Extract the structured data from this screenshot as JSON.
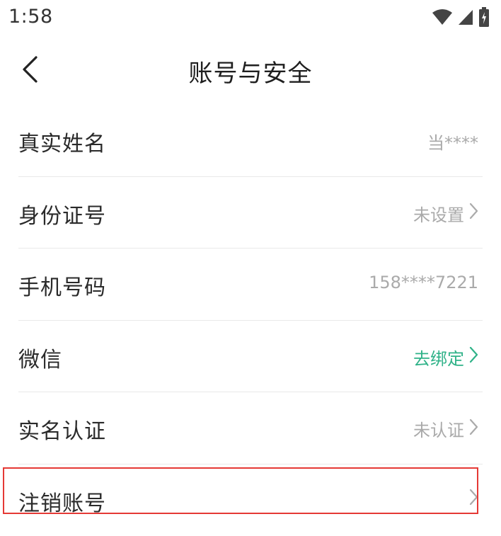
{
  "status_bar": {
    "time": "1:58",
    "icons": [
      "wifi-icon",
      "cell-signal-icon",
      "battery-icon"
    ]
  },
  "header": {
    "title": "账号与安全",
    "back_icon": "chevron-left-icon"
  },
  "rows": [
    {
      "label": "真实姓名",
      "value": "当****",
      "chevron": false,
      "color": "#aaaaaa"
    },
    {
      "label": "身份证号",
      "value": "未设置",
      "chevron": true,
      "color": "#aaaaaa"
    },
    {
      "label": "手机号码",
      "value": "158****7221",
      "chevron": false,
      "color": "#aaaaaa"
    },
    {
      "label": "微信",
      "value": "去绑定",
      "chevron": true,
      "color": "#2fb288"
    },
    {
      "label": "实名认证",
      "value": "未认证",
      "chevron": true,
      "color": "#aaaaaa"
    },
    {
      "label": "注销账号",
      "value": "",
      "chevron": true,
      "color": "#aaaaaa"
    }
  ],
  "colors": {
    "accent_green": "#2fb288",
    "highlight_red": "#e53935",
    "divider": "#e9e9e9"
  }
}
